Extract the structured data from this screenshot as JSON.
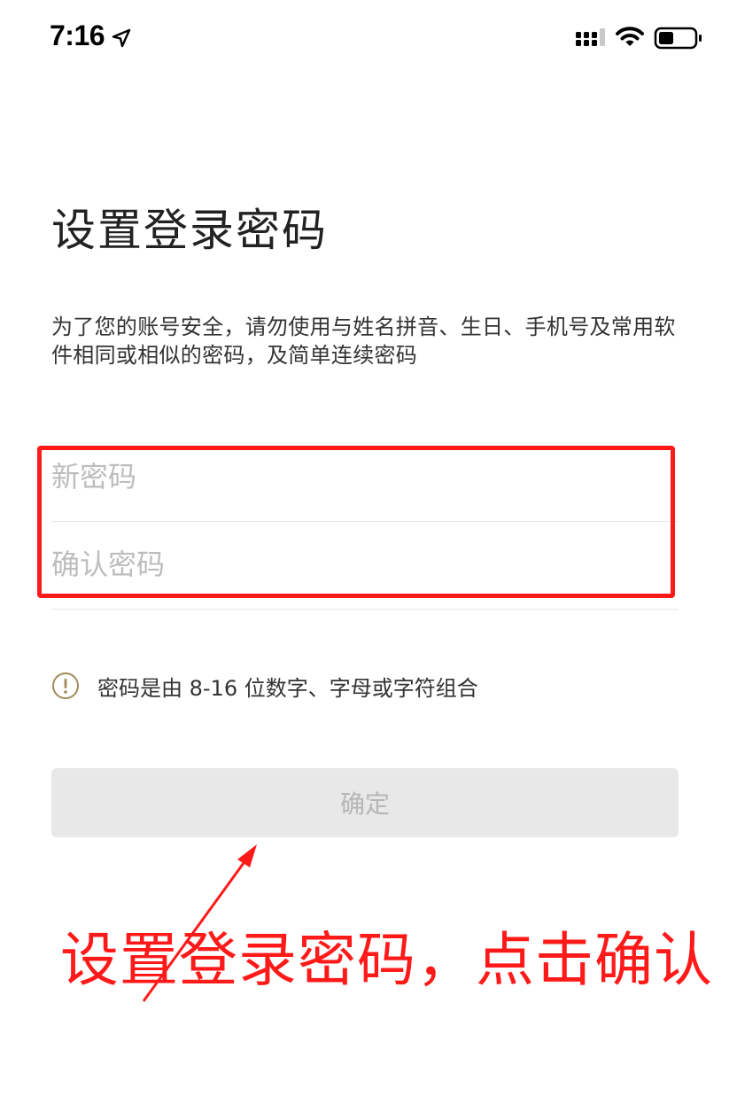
{
  "status_bar": {
    "time": "7:16",
    "location_icon": "location-arrow-icon",
    "cellular_icon": "cellular-signal-icon",
    "wifi_icon": "wifi-icon",
    "battery_icon": "battery-icon"
  },
  "title": "设置登录密码",
  "description": "为了您的账号安全，请勿使用与姓名拼音、生日、手机号及常用软件相同或相似的密码，及简单连续密码",
  "form": {
    "new_password_placeholder": "新密码",
    "confirm_password_placeholder": "确认密码"
  },
  "hint": {
    "icon": "exclamation-circle-icon",
    "text": "密码是由 8-16 位数字、字母或字符组合"
  },
  "confirm_button": {
    "label": "确定"
  },
  "annotation": {
    "text": "设置登录密码，点击确认",
    "color": "#ff1a1a"
  },
  "colors": {
    "title_text": "#222222",
    "placeholder": "#bdbdbd",
    "button_bg": "#e8e8e8",
    "button_text": "#b6b6b6",
    "hint_icon": "#a08c5a",
    "highlight": "#ff1a1a"
  }
}
